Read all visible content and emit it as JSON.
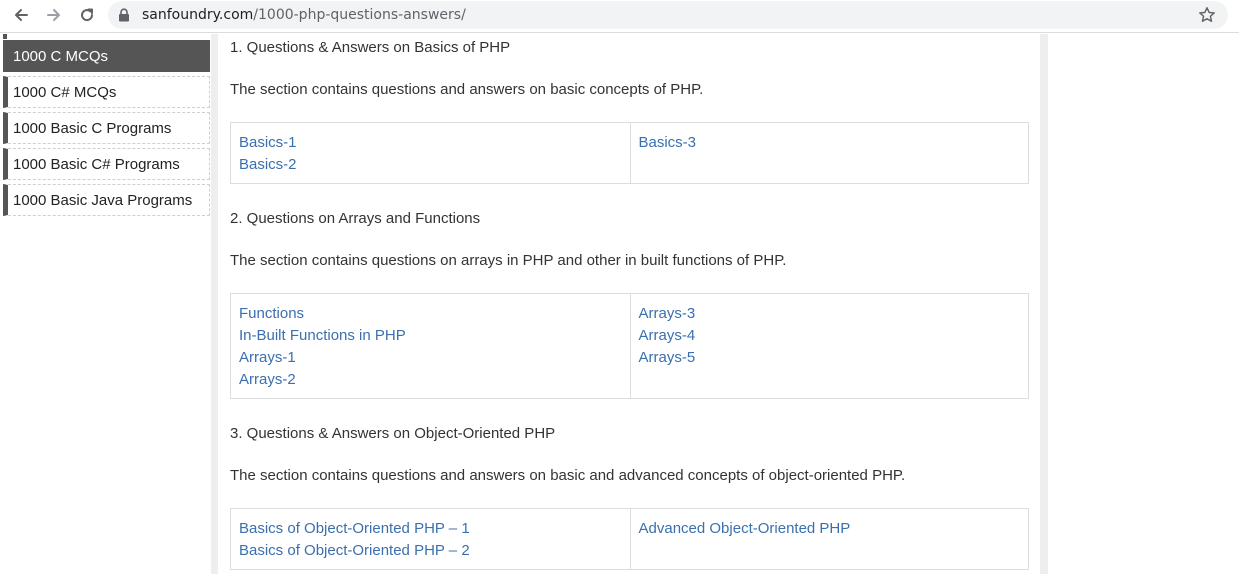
{
  "browser": {
    "url_host": "sanfoundry.com",
    "url_path": "/1000-php-questions-answers/"
  },
  "sidebar": {
    "items": [
      {
        "label": "1000 C MCQs",
        "active": true
      },
      {
        "label": "1000 C# MCQs",
        "active": false
      },
      {
        "label": "1000 Basic C Programs",
        "active": false
      },
      {
        "label": "1000 Basic C# Programs",
        "active": false
      },
      {
        "label": "1000 Basic Java Programs",
        "active": false
      }
    ]
  },
  "sections": [
    {
      "title": "1. Questions & Answers on Basics of PHP",
      "description": "The section contains questions and answers on basic concepts of PHP.",
      "col1": [
        "Basics-1",
        "Basics-2"
      ],
      "col2": [
        "Basics-3"
      ]
    },
    {
      "title": "2. Questions on Arrays and Functions",
      "description": "The section contains questions on arrays in PHP and other in built functions of PHP.",
      "col1": [
        "Functions",
        "In-Built Functions in PHP",
        "Arrays-1",
        "Arrays-2"
      ],
      "col2": [
        "Arrays-3",
        "Arrays-4",
        "Arrays-5"
      ]
    },
    {
      "title": "3. Questions & Answers on Object-Oriented PHP",
      "description": "The section contains questions and answers on basic and advanced concepts of object-oriented PHP.",
      "col1": [
        "Basics of Object-Oriented PHP – 1",
        "Basics of Object-Oriented PHP – 2"
      ],
      "col2": [
        "Advanced Object-Oriented PHP"
      ]
    }
  ],
  "colors": {
    "link": "#3a6fb0",
    "sidebar_active_bg": "#555555",
    "gutter": "#eeeeee"
  },
  "icons": [
    "back-arrow-icon",
    "forward-arrow-icon",
    "reload-icon",
    "lock-icon",
    "star-icon"
  ]
}
